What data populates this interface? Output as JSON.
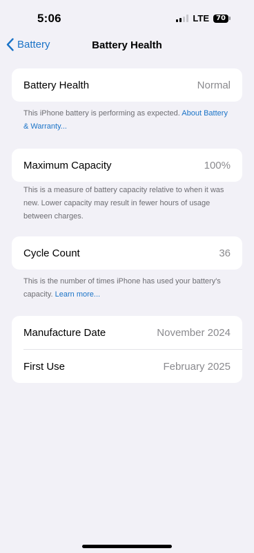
{
  "status_bar": {
    "time": "5:06",
    "network": "LTE",
    "battery_level": "70",
    "signal_bars_active": 2
  },
  "nav": {
    "back_label": "Battery",
    "title": "Battery Health"
  },
  "health": {
    "label": "Battery Health",
    "value": "Normal",
    "note": "This iPhone battery is performing as expected.",
    "link": "About Battery & Warranty..."
  },
  "capacity": {
    "label": "Maximum Capacity",
    "value": "100%",
    "note": "This is a measure of battery capacity relative to when it was new. Lower capacity may result in fewer hours of usage between charges."
  },
  "cycles": {
    "label": "Cycle Count",
    "value": "36",
    "note": "This is the number of times iPhone has used your battery's capacity.",
    "link": "Learn more..."
  },
  "dates": {
    "manufacture_label": "Manufacture Date",
    "manufacture_value": "November 2024",
    "first_use_label": "First Use",
    "first_use_value": "February 2025"
  },
  "colors": {
    "accent": "#1a73c7",
    "background": "#f2f1f7",
    "secondary_text": "#8a8a8e"
  }
}
